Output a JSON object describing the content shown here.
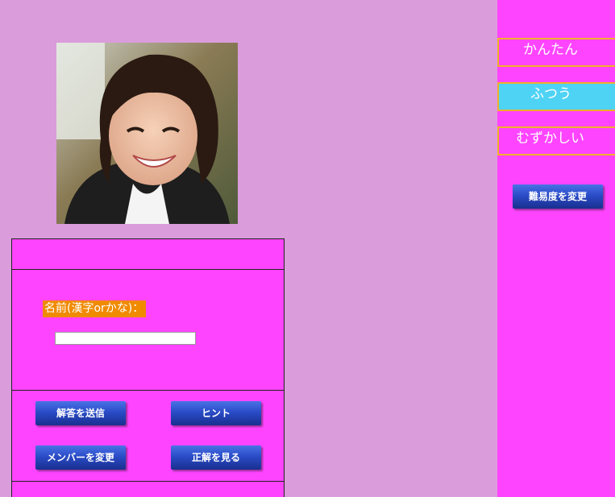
{
  "photo": {
    "alt": "smiling woman portrait"
  },
  "quiz": {
    "name_label": "名前(漢字orかな)：",
    "name_input_value": "",
    "name_input_placeholder": ""
  },
  "buttons": {
    "submit": "解答を送信",
    "hint": "ヒント",
    "change_member": "メンバーを変更",
    "show_answer": "正解を見る"
  },
  "difficulty": {
    "easy": "かんたん",
    "normal": "ふつう",
    "hard": "むずかしい",
    "selected": "ふつう",
    "change_button": "難易度を変更"
  },
  "colors": {
    "background": "#da9cdb",
    "panel": "#ff44ff",
    "label_bg": "#f08a00",
    "selected_bg": "#4fd3f4",
    "button": "#2a4cc8",
    "border_accent": "#f0b02a"
  }
}
